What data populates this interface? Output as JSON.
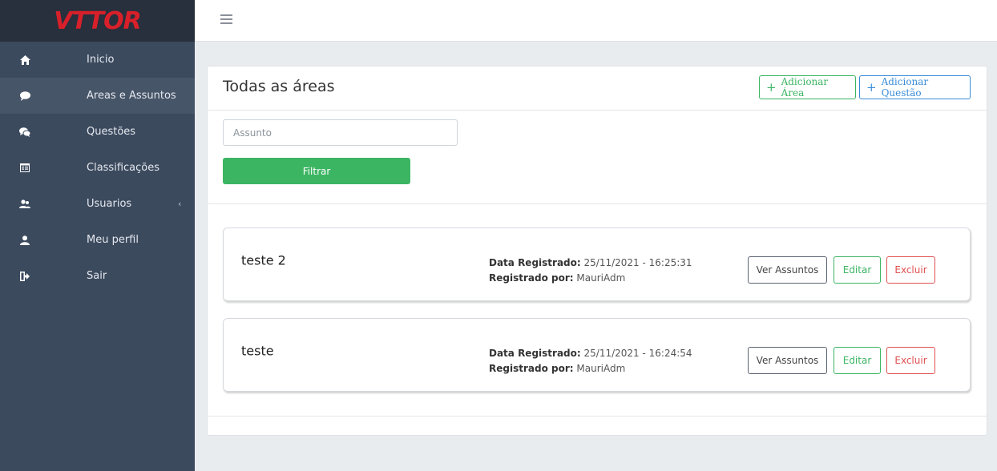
{
  "brand": {
    "name": "VTTOR"
  },
  "sidebar": {
    "items": [
      {
        "label": "Inicio",
        "icon": "home-icon",
        "active": false
      },
      {
        "label": "Areas e Assuntos",
        "icon": "comment-icon",
        "active": true
      },
      {
        "label": "Questões",
        "icon": "comments-icon",
        "active": false
      },
      {
        "label": "Classificações",
        "icon": "list-card-icon",
        "active": false
      },
      {
        "label": "Usuarios",
        "icon": "users-icon",
        "active": false,
        "caret": "‹"
      },
      {
        "label": "Meu perfil",
        "icon": "user-icon",
        "active": false
      },
      {
        "label": "Sair",
        "icon": "sign-out-icon",
        "active": false
      }
    ]
  },
  "page": {
    "title": "Todas as áreas",
    "add_area_plus": "+",
    "add_area_label": "Adicionar Área",
    "add_question_plus": "+",
    "add_question_label": "Adicionar Questão",
    "filter": {
      "placeholder": "Assunto",
      "button_label": "Filtrar"
    }
  },
  "areas": [
    {
      "name": "teste 2",
      "date_label": "Data Registrado:",
      "date_value": "25/11/2021 - 16:25:31",
      "by_label": "Registrado por:",
      "by_value": "MauriAdm",
      "view_label": "Ver Assuntos",
      "edit_label": "Editar",
      "delete_label": "Excluir"
    },
    {
      "name": "teste",
      "date_label": "Data Registrado:",
      "date_value": "25/11/2021 - 16:24:54",
      "by_label": "Registrado por:",
      "by_value": "MauriAdm",
      "view_label": "Ver Assuntos",
      "edit_label": "Editar",
      "delete_label": "Excluir"
    }
  ],
  "colors": {
    "brand": "#d8202a",
    "sidebar": "#3c4a5e",
    "sidebar_active": "#475568",
    "success": "#3cb563",
    "primary": "#3a8cd8",
    "danger": "#e05050"
  }
}
